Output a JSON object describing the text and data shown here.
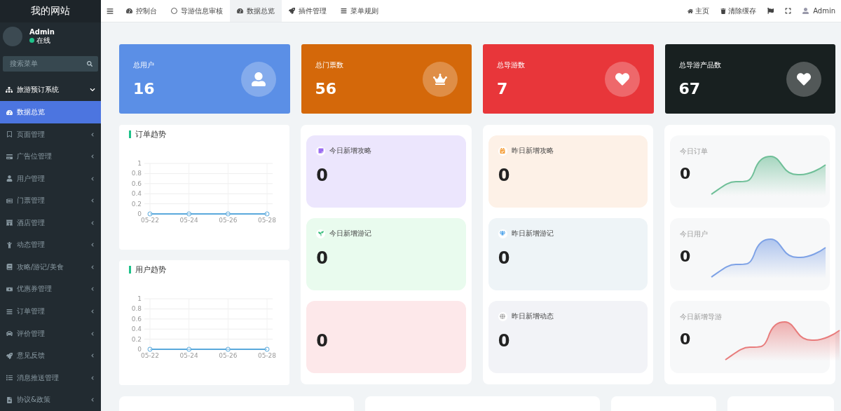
{
  "sidebar": {
    "site_title": "我的网站",
    "user": {
      "name": "Admin",
      "status": "在线",
      "online": true
    },
    "search": {
      "placeholder": "搜索菜单"
    },
    "group": {
      "label": "旅游预订系统",
      "expanded": true
    },
    "items": [
      {
        "label": "数据总览",
        "selected": true
      },
      {
        "label": "页面管理",
        "selected": false
      },
      {
        "label": "广告位管理",
        "selected": false
      },
      {
        "label": "用户管理",
        "selected": false
      },
      {
        "label": "门票管理",
        "selected": false
      },
      {
        "label": "酒店管理",
        "selected": false
      },
      {
        "label": "动态管理",
        "selected": false
      },
      {
        "label": "攻略/游记/美食",
        "selected": false
      },
      {
        "label": "优惠券管理",
        "selected": false
      },
      {
        "label": "订单管理",
        "selected": false
      },
      {
        "label": "评价管理",
        "selected": false
      },
      {
        "label": "意见反馈",
        "selected": false
      },
      {
        "label": "消息推送管理",
        "selected": false
      },
      {
        "label": "协议&政策",
        "selected": false
      }
    ]
  },
  "topbar": {
    "tabs": [
      {
        "label": "控制台",
        "selected": false
      },
      {
        "label": "导游信息审核",
        "selected": false
      },
      {
        "label": "数据总览",
        "selected": true
      },
      {
        "label": "插件管理",
        "selected": false
      },
      {
        "label": "菜单规则",
        "selected": false
      }
    ],
    "links": [
      {
        "label": "主页"
      },
      {
        "label": "清除缓存"
      }
    ],
    "user": "Admin"
  },
  "stats": [
    {
      "label": "总用户",
      "value": "16",
      "color": "#5b8fe6"
    },
    {
      "label": "总门票数",
      "value": "56",
      "color": "#d4680a"
    },
    {
      "label": "总导游数",
      "value": "7",
      "color": "#e8363a"
    },
    {
      "label": "总导游产品数",
      "value": "67",
      "color": "#182020"
    }
  ],
  "trends": [
    {
      "title": "订单趋势",
      "chart_data": {
        "type": "line",
        "categories": [
          "05-22",
          "05-24",
          "05-26",
          "05-28"
        ],
        "ylim": [
          0,
          1
        ],
        "yticks": [
          0,
          0.2,
          0.4,
          0.6,
          0.8,
          1
        ],
        "grid": true,
        "series": [
          {
            "color": "#5aa9dc",
            "marker": true,
            "values": [
              0,
              0,
              0,
              0
            ]
          }
        ]
      }
    },
    {
      "title": "用户趋势",
      "chart_data": {
        "type": "line",
        "categories": [
          "05-22",
          "05-24",
          "05-26",
          "05-28"
        ],
        "ylim": [
          0,
          1
        ],
        "yticks": [
          0,
          0.2,
          0.4,
          0.6,
          0.8,
          1
        ],
        "grid": true,
        "series": [
          {
            "color": "#5aa9dc",
            "marker": true,
            "values": [
              0,
              0,
              0,
              0
            ]
          }
        ]
      }
    }
  ],
  "new_columns": [
    [
      {
        "label": "今日新增攻略",
        "value": "0",
        "color": "#ece6fd"
      },
      {
        "label": "今日新增游记",
        "value": "0",
        "color": "#e9fbee"
      },
      {
        "value": "0",
        "color": "#fde8ea"
      }
    ],
    [
      {
        "label": "昨日新增攻略",
        "value": "0",
        "color": "#fdf1e7"
      },
      {
        "label": "昨日新增游记",
        "value": "0",
        "color": "#eef4f7"
      },
      {
        "label": "昨日新增动态",
        "value": "0",
        "color": "#f2f3f7"
      }
    ]
  ],
  "spark_cards": [
    {
      "label": "今日订单",
      "value": "0",
      "color": "#6fbf98"
    },
    {
      "label": "今日用户",
      "value": "0",
      "color": "#7ea2e6"
    },
    {
      "label": "今日新增导游",
      "value": "0",
      "color": "#e87c7c"
    }
  ]
}
